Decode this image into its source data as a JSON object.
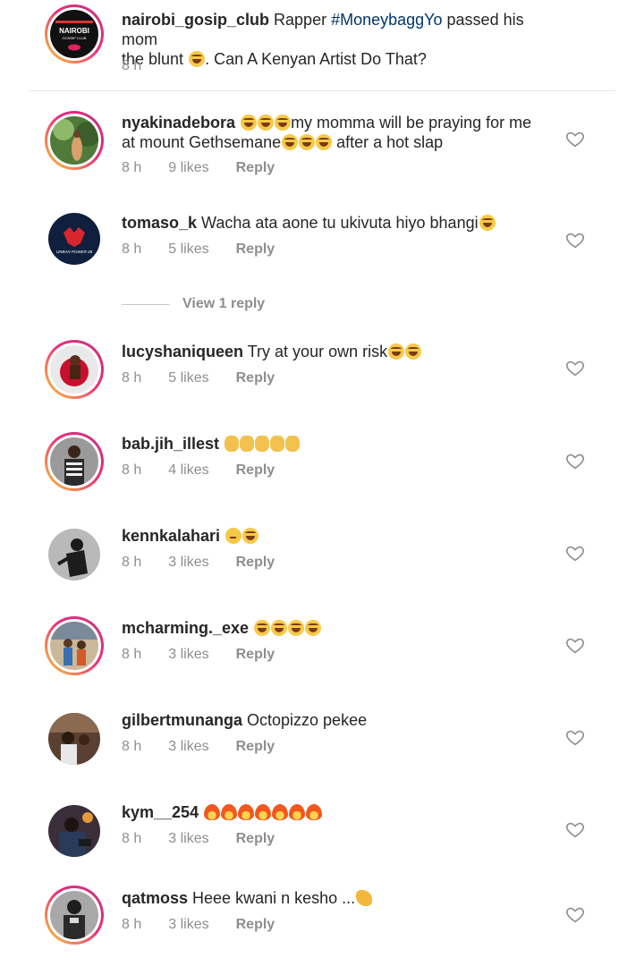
{
  "caption": {
    "username": "nairobi_gosip_club",
    "text_before": " Rapper ",
    "hashtag": "#MoneybaggYo",
    "text_after_line1": " passed his mom",
    "text_line2_a": "the blunt ",
    "text_line2_b": ". Can A Kenyan Artist Do That?",
    "time": "8 h",
    "avatar_text_line1": "NAIROBI",
    "avatar_text_line2": "GOSSIP CLUB"
  },
  "comments": [
    {
      "username": "nyakinadebora",
      "line1_a": " ",
      "line1_b": "my momma will be praying for me",
      "line2_a": "at mount Gethsemane",
      "line2_b": " after a hot slap",
      "time": "8 h",
      "likes": "9 likes",
      "reply": "Reply"
    },
    {
      "username": "tomaso_k",
      "text": " Wacha ata  aone tu ukivuta hiyo bhangi",
      "time": "8 h",
      "likes": "5 likes",
      "reply": "Reply",
      "view_replies": "View 1 reply",
      "avatar_text": "URBAN POWER 08"
    },
    {
      "username": "lucyshaniqueen",
      "text": " Try at your own risk",
      "time": "8 h",
      "likes": "5 likes",
      "reply": "Reply"
    },
    {
      "username": "bab.jih_illest",
      "text": " ",
      "time": "8 h",
      "likes": "4 likes",
      "reply": "Reply"
    },
    {
      "username": "kennkalahari",
      "text": " ",
      "time": "8 h",
      "likes": "3 likes",
      "reply": "Reply"
    },
    {
      "username": "mcharming._exe",
      "text": " ",
      "time": "8 h",
      "likes": "3 likes",
      "reply": "Reply"
    },
    {
      "username": "gilbertmunanga",
      "text": " Octopizzo pekee",
      "time": "8 h",
      "likes": "3 likes",
      "reply": "Reply"
    },
    {
      "username": "kym__254",
      "text": " ",
      "time": "8 h",
      "likes": "3 likes",
      "reply": "Reply"
    },
    {
      "username": "qatmoss",
      "text": " Heee kwani n kesho ...",
      "time": "8 h",
      "likes": "3 likes",
      "reply": "Reply"
    }
  ],
  "colors": {
    "text": "#262626",
    "muted": "#8e8e8e",
    "hashtag": "#00376b",
    "story_ring_start": "#f9ce34",
    "story_ring_end": "#c13584"
  },
  "icons": [
    "heart-outline-icon",
    "laughing-emoji",
    "thinking-emoji",
    "fire-emoji",
    "clap-emoji",
    "waving-hand-emoji"
  ]
}
